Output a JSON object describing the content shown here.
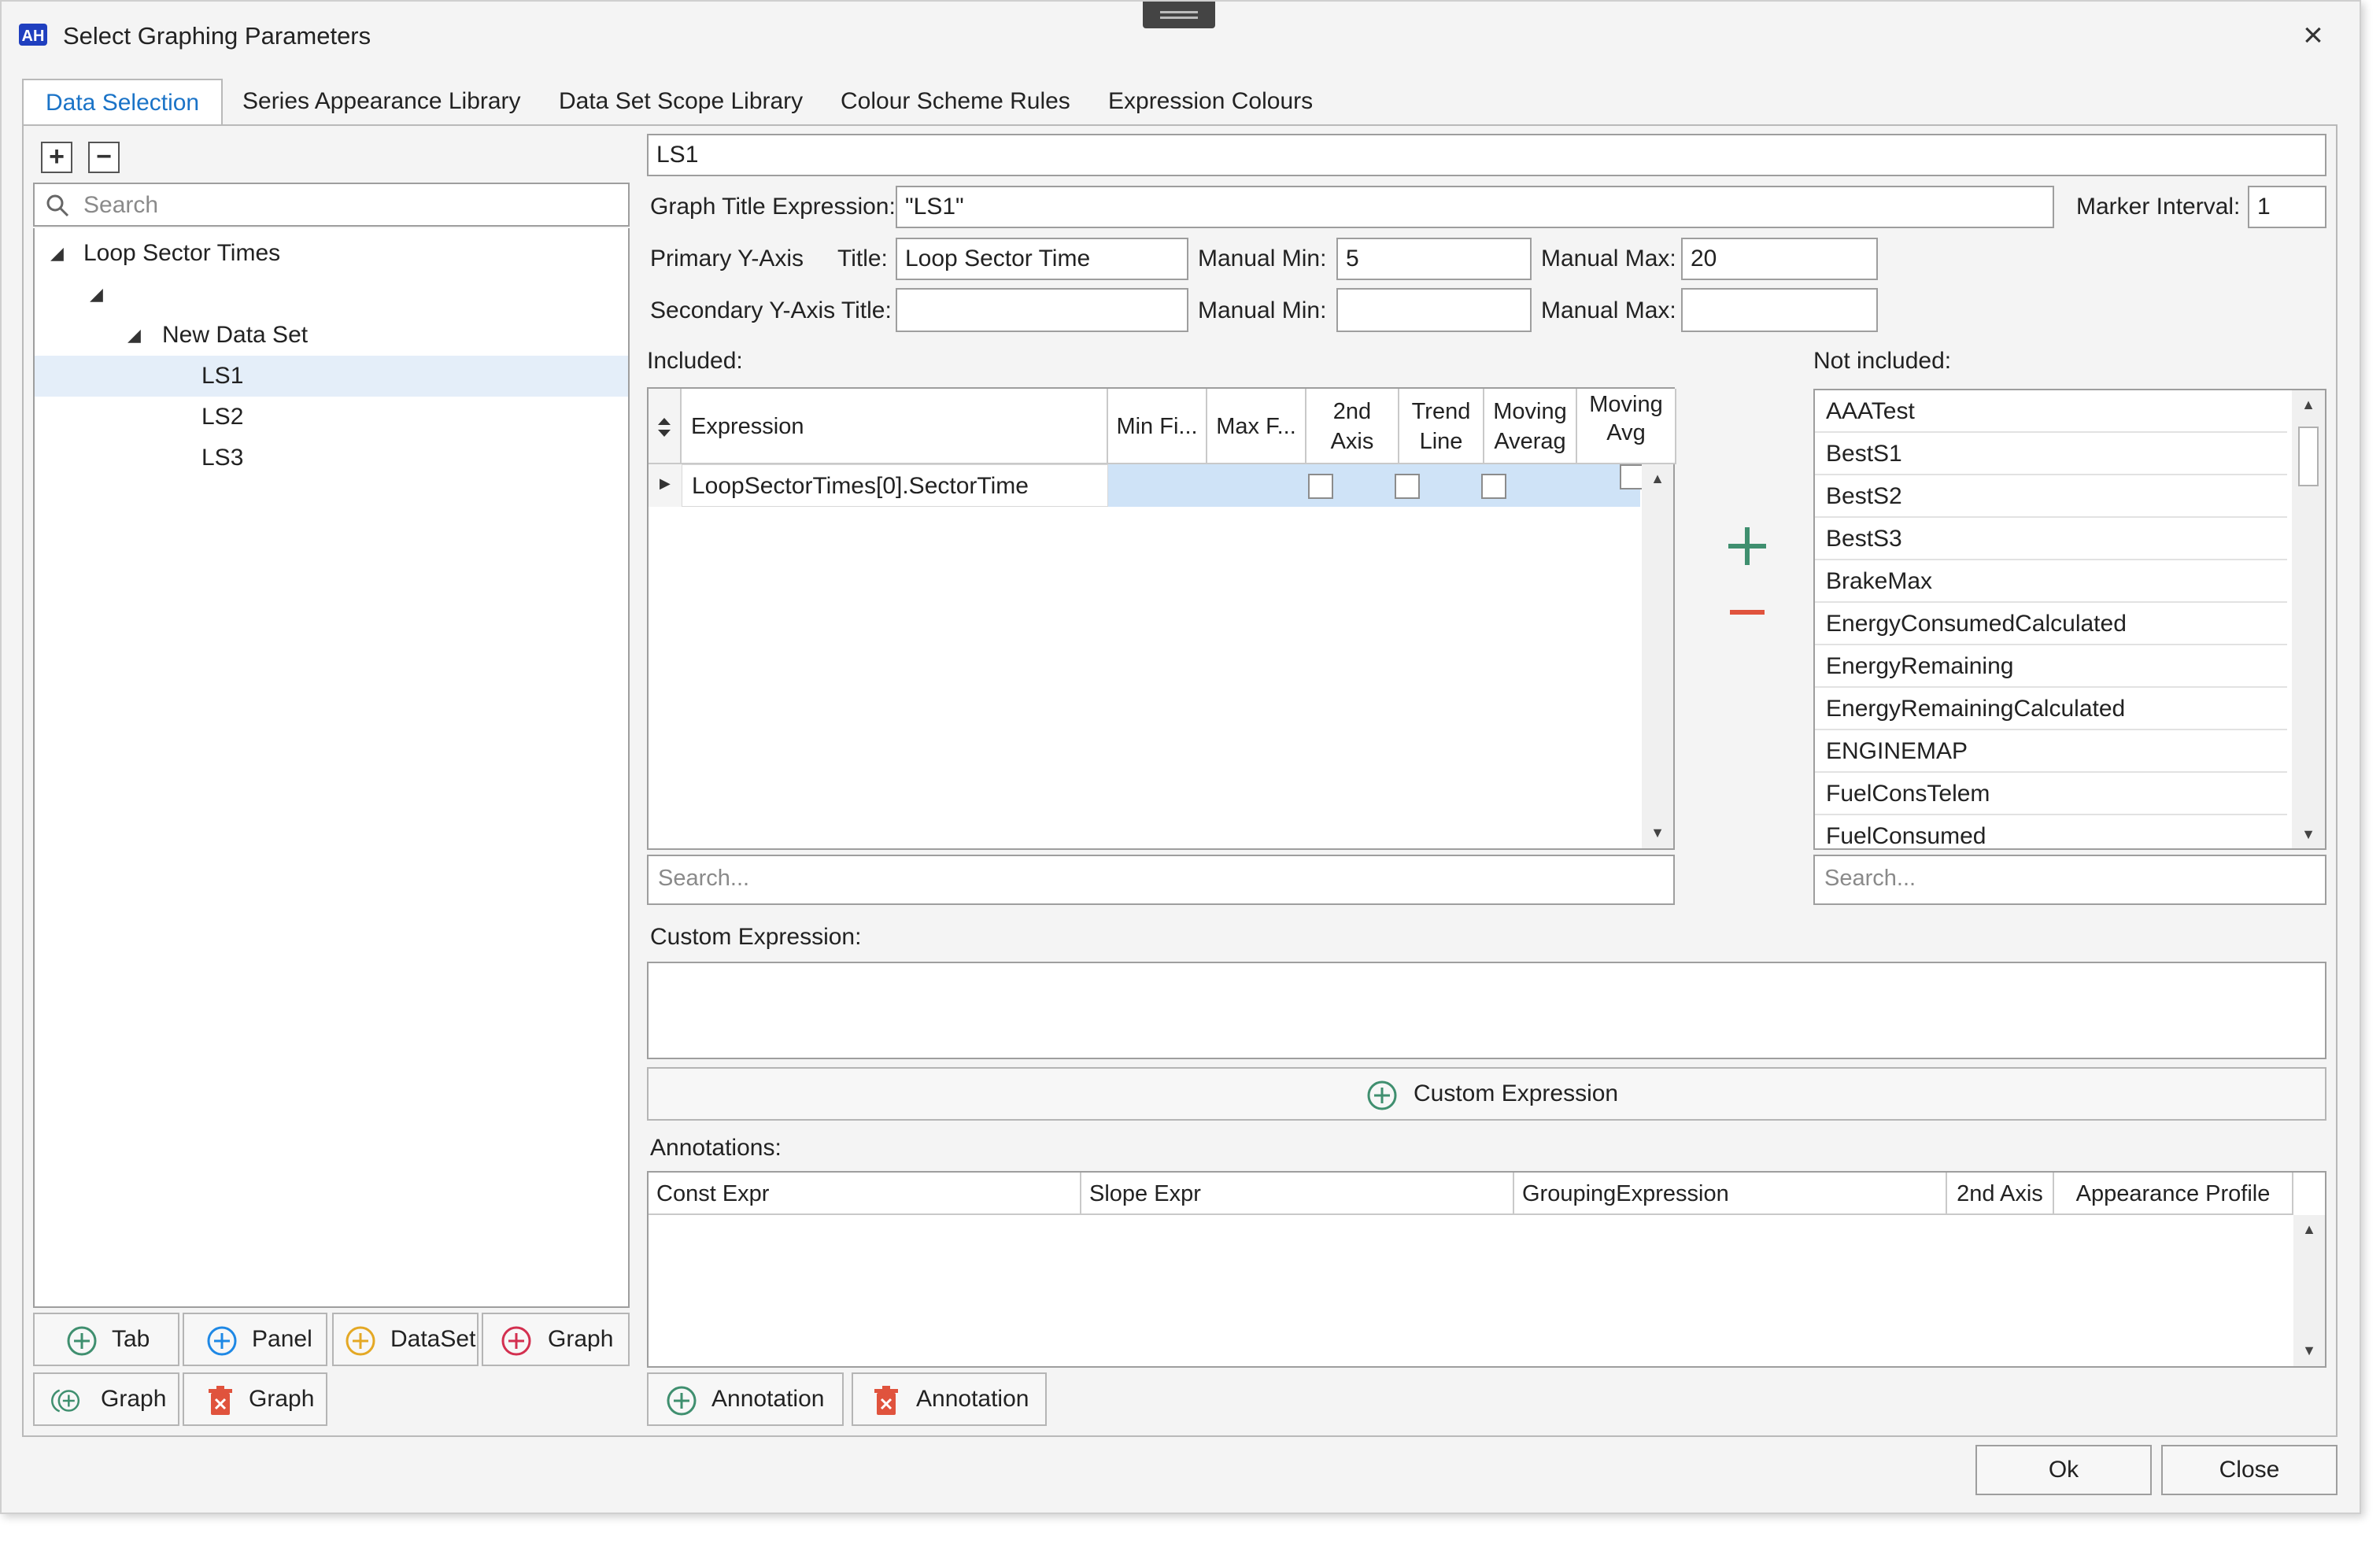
{
  "window": {
    "title": "Select Graphing Parameters"
  },
  "tabs": [
    {
      "label": "Data Selection"
    },
    {
      "label": "Series Appearance Library"
    },
    {
      "label": "Data Set Scope Library"
    },
    {
      "label": "Colour Scheme Rules"
    },
    {
      "label": "Expression Colours"
    }
  ],
  "tree": {
    "search_placeholder": "Search",
    "nodes": [
      {
        "label": "Loop Sector Times"
      },
      {
        "label": ""
      },
      {
        "label": "New Data Set"
      },
      {
        "label": "LS1"
      },
      {
        "label": "LS2"
      },
      {
        "label": "LS3"
      }
    ],
    "selected": "LS1"
  },
  "left_buttons": {
    "tab": "Tab",
    "panel": "Panel",
    "dataset": "DataSet",
    "graph_add": "Graph",
    "graph_copy": "Graph",
    "graph_delete": "Graph"
  },
  "form": {
    "name_value": "LS1",
    "graph_title_label": "Graph Title Expression:",
    "graph_title_value": "\"LS1\"",
    "marker_interval_label": "Marker Interval:",
    "marker_interval_value": "1",
    "primary_label": "Primary Y-Axis",
    "title_label": "Title:",
    "primary_title_value": "Loop Sector Time",
    "manual_min_label": "Manual Min:",
    "manual_max_label": "Manual Max:",
    "primary_min_value": "5",
    "primary_max_value": "20",
    "secondary_label": "Secondary Y-Axis Title:",
    "secondary_title_value": "",
    "secondary_min_value": "",
    "secondary_max_value": ""
  },
  "included": {
    "label": "Included:",
    "columns": {
      "expression": "Expression",
      "min_fi": "Min Fi...",
      "max_f": "Max F...",
      "second_axis_1": "2nd",
      "second_axis_2": "Axis",
      "trend_1": "Trend",
      "trend_2": "Line",
      "moving_avg_1": "Moving",
      "moving_avg_2": "Averag",
      "moving_avg2_1": "Moving",
      "moving_avg2_2": "Avg"
    },
    "rows": [
      {
        "expression": "LoopSectorTimes[0].SectorTime",
        "second_axis": false,
        "trend_line": false,
        "moving_average": false
      }
    ],
    "search_placeholder": "Search..."
  },
  "not_included": {
    "label": "Not included:",
    "items": [
      "AAATest",
      "BestS1",
      "BestS2",
      "BestS3",
      "BrakeMax",
      "EnergyConsumedCalculated",
      "EnergyRemaining",
      "EnergyRemainingCalculated",
      "ENGINEMAP",
      "FuelConsTelem",
      "FuelConsumed"
    ],
    "search_placeholder": "Search..."
  },
  "custom_expression": {
    "label": "Custom Expression:",
    "value": "",
    "button": "Custom Expression"
  },
  "annotations": {
    "label": "Annotations:",
    "columns": [
      "Const Expr",
      "Slope Expr",
      "GroupingExpression",
      "2nd Axis",
      "Appearance Profile"
    ],
    "add_button": "Annotation",
    "delete_button": "Annotation"
  },
  "footer": {
    "ok": "Ok",
    "close": "Close"
  },
  "colors": {
    "accent": "#1a73c7",
    "green_plus": "#3f8f6f",
    "red_minus": "#e0533d",
    "blue_plus": "#1e88e5",
    "yellow_plus": "#e4a824",
    "red_plus": "#d32f4f",
    "selection": "#cfe3f7"
  }
}
